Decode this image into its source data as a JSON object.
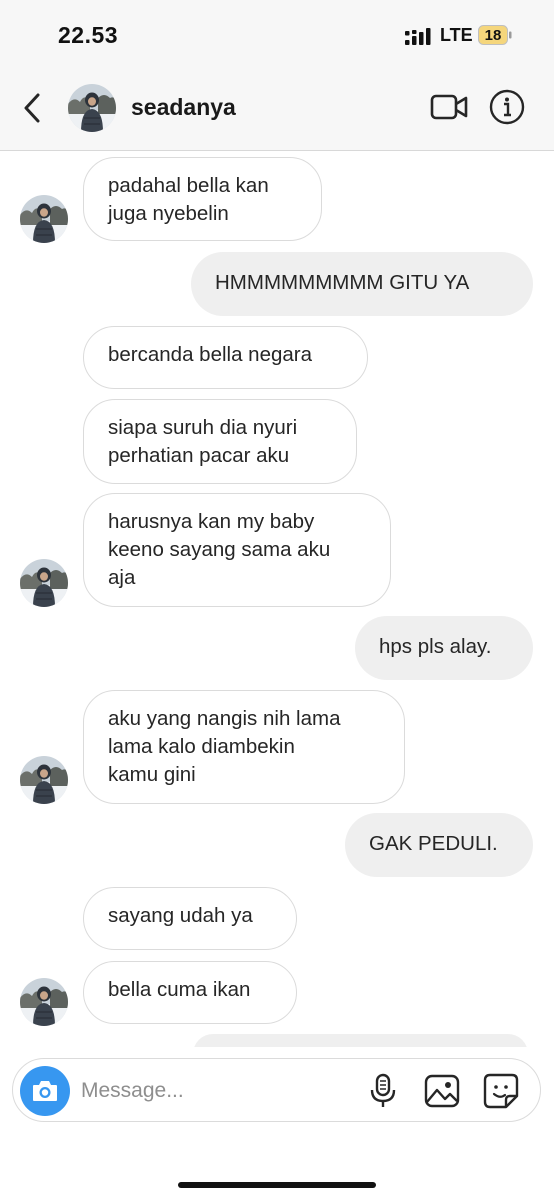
{
  "status_bar": {
    "time": "22.53",
    "network": "LTE",
    "battery": "18"
  },
  "header": {
    "username": "seadanya"
  },
  "messages": [
    {
      "side": "in",
      "text": "padahal bella kan\njuga nyebelin"
    },
    {
      "side": "out",
      "text": "HMMMMMMMMM GITU YA"
    },
    {
      "side": "in",
      "text": "bercanda bella negara"
    },
    {
      "side": "in",
      "text": "siapa suruh dia nyuri\nperhatian pacar aku"
    },
    {
      "side": "in",
      "text": "harusnya kan my baby\nkeeno sayang sama aku\naja"
    },
    {
      "side": "out",
      "text": "hps pls alay."
    },
    {
      "side": "in",
      "text": "aku yang nangis nih lama\nlama kalo diambekin\nkamu gini"
    },
    {
      "side": "out",
      "text": "GAK PEDULI."
    },
    {
      "side": "in",
      "text": "sayang udah ya"
    },
    {
      "side": "in",
      "text": "bella cuma ikan"
    }
  ],
  "composer": {
    "placeholder": "Message..."
  },
  "icons": {
    "back": "chevron-left-icon",
    "video": "video-camera-icon",
    "info": "info-icon",
    "camera": "camera-icon",
    "mic": "microphone-icon",
    "gallery": "image-icon",
    "sticker": "sticker-icon"
  },
  "colors": {
    "accent": "#3797f0",
    "outgoing_bubble": "#efefef",
    "incoming_border": "#dbdbdb"
  }
}
